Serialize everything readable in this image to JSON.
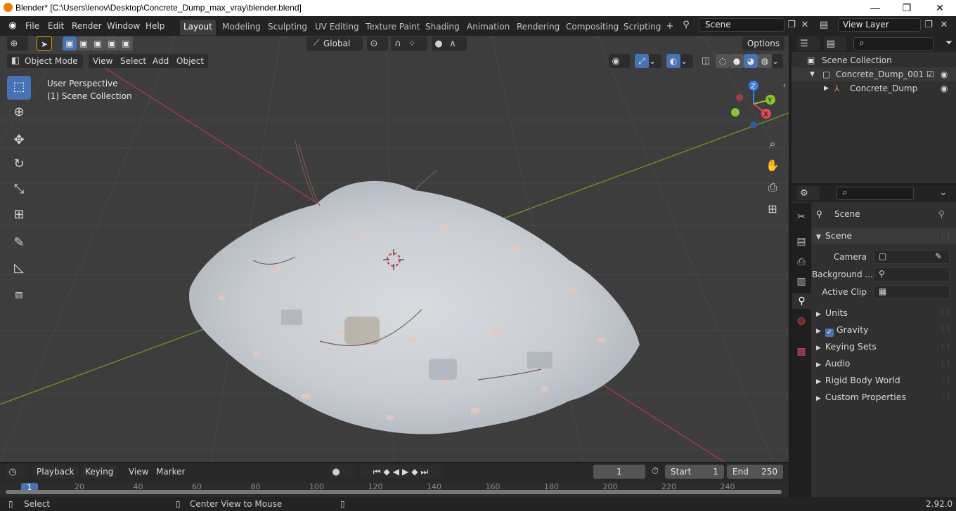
{
  "window": {
    "title": "Blender* [C:\\Users\\lenov\\Desktop\\Concrete_Dump_max_vray\\blender.blend]",
    "minimize": "—",
    "maximize": "❐",
    "close": "✕"
  },
  "menubar": [
    "File",
    "Edit",
    "Render",
    "Window",
    "Help"
  ],
  "workspaces": [
    "Layout",
    "Modeling",
    "Sculpting",
    "UV Editing",
    "Texture Paint",
    "Shading",
    "Animation",
    "Rendering",
    "Compositing",
    "Scripting"
  ],
  "active_workspace": "Layout",
  "scene_field": "Scene",
  "view_layer_field": "View Layer",
  "header": {
    "orientation": "Global",
    "options": "Options"
  },
  "viewport_menu": {
    "mode": "Object Mode",
    "items": [
      "View",
      "Select",
      "Add",
      "Object"
    ]
  },
  "viewport_overlay": {
    "perspective": "User Perspective",
    "collection": "(1) Scene Collection"
  },
  "gizmo": {
    "x": "X",
    "y": "Y",
    "z": "Z"
  },
  "outliner": {
    "root": "Scene Collection",
    "collection": "Concrete_Dump_001",
    "object": "Concrete_Dump"
  },
  "properties": {
    "context": "Scene",
    "panel": "Scene",
    "fields": [
      {
        "label": "Camera"
      },
      {
        "label": "Background ..."
      },
      {
        "label": "Active Clip"
      }
    ],
    "sections": [
      "Units",
      "Gravity",
      "Keying Sets",
      "Audio",
      "Rigid Body World",
      "Custom Properties"
    ],
    "gravity_checked": true
  },
  "timeline": {
    "menus": [
      "Playback",
      "Keying",
      "View",
      "Marker"
    ],
    "current_frame": "1",
    "start_label": "Start",
    "start": "1",
    "end_label": "End",
    "end": "250",
    "ruler": [
      "1",
      "20",
      "40",
      "60",
      "80",
      "100",
      "120",
      "140",
      "160",
      "180",
      "200",
      "220",
      "240"
    ]
  },
  "status": {
    "left": "Select",
    "middle": "Center View to Mouse",
    "version": "2.92.0"
  },
  "colors": {
    "active_blue": "#4772b3",
    "x_axis": "#e8465b",
    "y_axis": "#8bc52d",
    "z_axis": "#3b7de6"
  }
}
